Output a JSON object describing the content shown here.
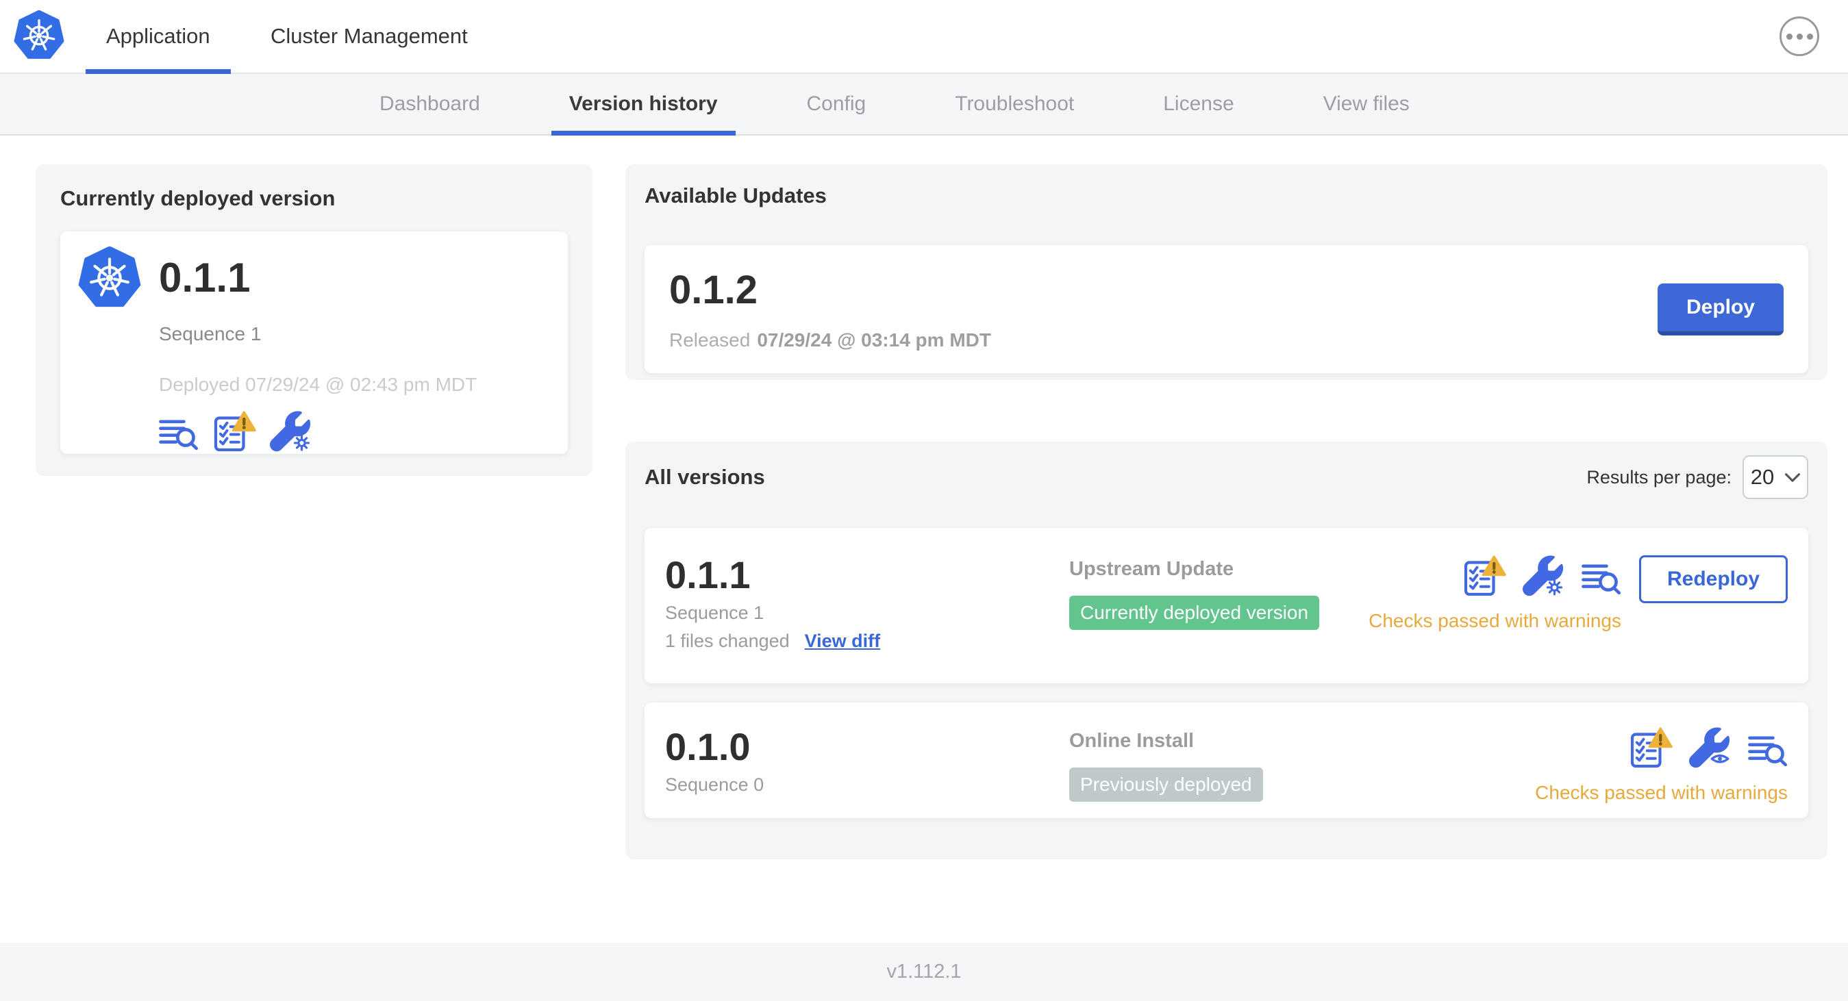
{
  "topnav": {
    "tabs": [
      {
        "label": "Application",
        "active": true
      },
      {
        "label": "Cluster Management",
        "active": false
      }
    ],
    "menu_icon": "ellipsis-icon",
    "brand_icon": "kubernetes-logo"
  },
  "subnav": {
    "tabs": [
      {
        "label": "Dashboard",
        "active": false
      },
      {
        "label": "Version history",
        "active": true
      },
      {
        "label": "Config",
        "active": false
      },
      {
        "label": "Troubleshoot",
        "active": false
      },
      {
        "label": "License",
        "active": false
      },
      {
        "label": "View files",
        "active": false
      }
    ]
  },
  "currently_deployed": {
    "title": "Currently deployed version",
    "version": "0.1.1",
    "sequence": "Sequence 1",
    "deployed_at": "Deployed 07/29/24 @ 02:43 pm MDT",
    "icons": [
      "view-files-icon",
      "preflight-checks-warning-icon",
      "edit-config-icon"
    ]
  },
  "available_updates": {
    "title": "Available Updates",
    "update": {
      "version": "0.1.2",
      "released_label": "Released",
      "released_at": "07/29/24 @ 03:14 pm MDT",
      "deploy_label": "Deploy"
    }
  },
  "all_versions": {
    "title": "All versions",
    "results_per_page_label": "Results per page:",
    "results_per_page_value": "20",
    "rows": [
      {
        "version": "0.1.1",
        "sequence": "Sequence 1",
        "files_changed": "1 files changed",
        "view_diff_label": "View diff",
        "source": "Upstream Update",
        "badge_label": "Currently deployed version",
        "badge_color": "#62c58e",
        "status": "Checks passed with warnings",
        "action_label": "Redeploy",
        "icons": [
          "preflight-checks-warning-icon",
          "edit-config-icon",
          "view-files-icon"
        ]
      },
      {
        "version": "0.1.0",
        "sequence": "Sequence 0",
        "source": "Online Install",
        "badge_label": "Previously deployed",
        "badge_color": "#bfc8cb",
        "status": "Checks passed with warnings",
        "icons": [
          "preflight-checks-warning-icon",
          "view-config-icon",
          "view-files-icon"
        ]
      }
    ]
  },
  "footer": {
    "app_version": "v1.112.1"
  },
  "colors": {
    "brand_blue": "#326de6",
    "accent_blue": "#3a66d6",
    "icon_blue": "#4268e2",
    "warning_amber": "#ecb23c",
    "status_amber": "#e7a93d",
    "badge_green": "#62c58e",
    "badge_gray": "#bfc8cb",
    "panel_gray": "#f4f5f7"
  }
}
